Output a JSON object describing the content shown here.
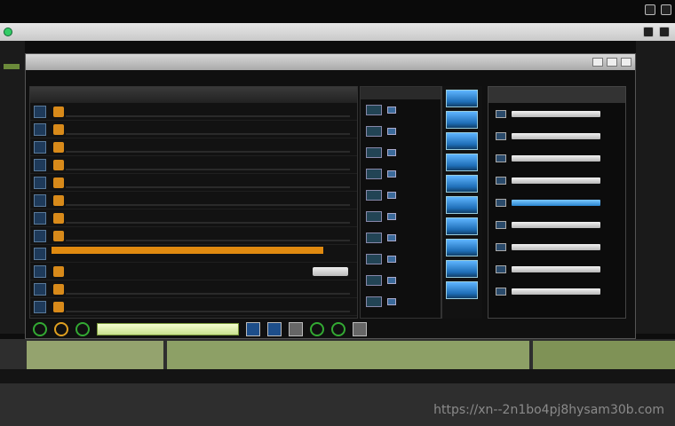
{
  "menubar": {
    "items": [
      "",
      "",
      "",
      "",
      "",
      ""
    ]
  },
  "address": {
    "text": ""
  },
  "window": {
    "title": ""
  },
  "left_panel": {
    "header": "",
    "rows": [
      {
        "label": ""
      },
      {
        "label": ""
      },
      {
        "label": ""
      },
      {
        "label": ""
      },
      {
        "label": ""
      },
      {
        "label": ""
      },
      {
        "label": ""
      },
      {
        "label": ""
      },
      {
        "label": ""
      },
      {
        "label": ""
      },
      {
        "label": ""
      },
      {
        "label": ""
      }
    ]
  },
  "right_panel": {
    "header": ""
  },
  "toolbar": {
    "search_text": ""
  },
  "footer": {
    "status": ""
  },
  "watermark": "https://xn--2n1bo4pj8hysam30b.com",
  "colors": {
    "accent_orange": "#e08a10",
    "accent_blue": "#2a86d0",
    "ground_green": "#8da066"
  }
}
